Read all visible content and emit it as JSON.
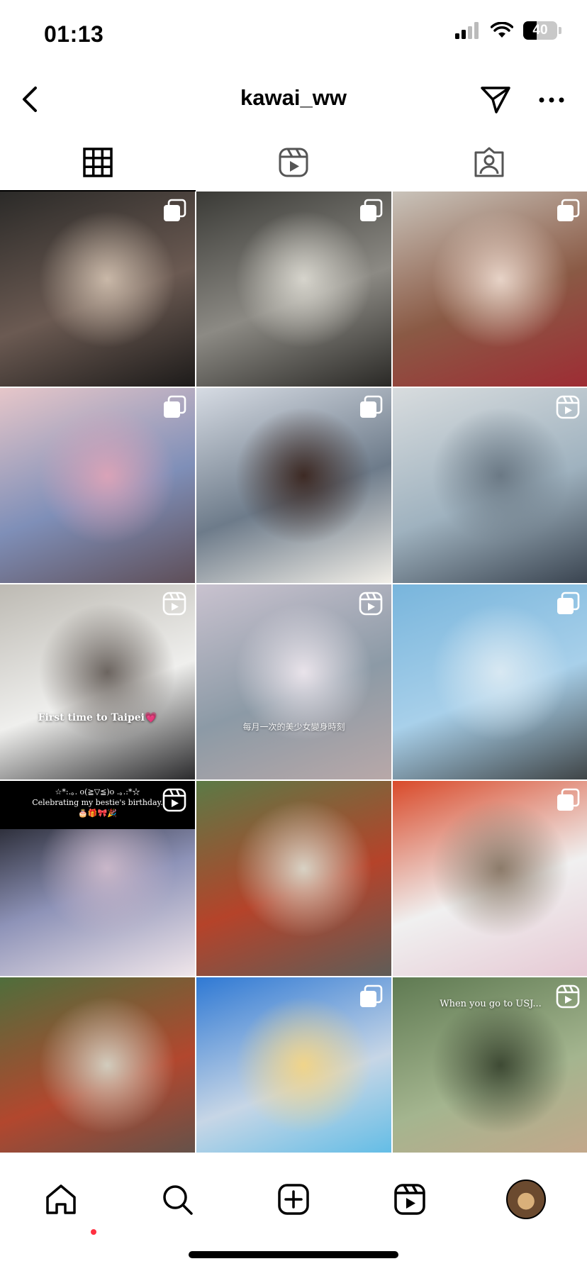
{
  "status": {
    "time": "01:13",
    "battery": "40",
    "battery_level": 0.4
  },
  "header": {
    "username": "kawai_ww"
  },
  "tabs": [
    {
      "name": "posts",
      "icon": "grid-icon",
      "active": true
    },
    {
      "name": "reels",
      "icon": "reels-icon",
      "active": false
    },
    {
      "name": "tagged",
      "icon": "tagged-icon",
      "active": false
    }
  ],
  "posts": [
    {
      "type": "carousel",
      "palette": [
        "#2b2a28",
        "#6b5a52",
        "#c9b8a8",
        "#1d1b1a"
      ]
    },
    {
      "type": "carousel",
      "palette": [
        "#3a3a36",
        "#8c8a84",
        "#d6d4cc",
        "#2a2926"
      ]
    },
    {
      "type": "carousel",
      "palette": [
        "#c9c3ba",
        "#8a5a45",
        "#e7d3c7",
        "#9e2c34"
      ]
    },
    {
      "type": "carousel",
      "palette": [
        "#e6c6c9",
        "#7f8fb8",
        "#d9a3b8",
        "#5e4e58"
      ]
    },
    {
      "type": "carousel",
      "palette": [
        "#d6dbe3",
        "#6d7b8a",
        "#3d2a24",
        "#f2efe8"
      ]
    },
    {
      "type": "reel",
      "palette": [
        "#d8dcde",
        "#9fb2bf",
        "#6b7985",
        "#3a4450"
      ]
    },
    {
      "type": "reel",
      "caption": "First time to Taipei💗",
      "palette": [
        "#bdbab3",
        "#efefed",
        "#6c6560",
        "#2b2b2d"
      ]
    },
    {
      "type": "reel",
      "caption": "每月一次的美少女變身時刻",
      "palette": [
        "#c9c2cf",
        "#8c9aa6",
        "#e9e3ea",
        "#b8a8a8"
      ]
    },
    {
      "type": "carousel",
      "palette": [
        "#78b5dc",
        "#a8d0ea",
        "#d8e8f2",
        "#3f4446"
      ]
    },
    {
      "type": "reel",
      "caption": "☆*:.｡. o(≧▽≦)o .｡.:*☆\nCelebrating my bestie's birthday.\n🎂🎁🎀🎉",
      "palette": [
        "#000000",
        "#8e93b8",
        "#c9b7c9",
        "#f0e6ea"
      ]
    },
    {
      "type": "none",
      "palette": [
        "#5b7a46",
        "#b5432a",
        "#d8d2c4",
        "#5f5d58"
      ]
    },
    {
      "type": "carousel",
      "palette": [
        "#d94a2a",
        "#f0f0f0",
        "#8c7b6a",
        "#e6c9d4"
      ]
    },
    {
      "type": "none",
      "palette": [
        "#4f6e3c",
        "#b2472e",
        "#d2ccbd",
        "#56544f"
      ]
    },
    {
      "type": "carousel",
      "palette": [
        "#2f79d4",
        "#c7d6e6",
        "#f0d48a",
        "#50b8e6"
      ]
    },
    {
      "type": "reel",
      "caption": "When you go to USJ...",
      "palette": [
        "#5f7a52",
        "#a4b58f",
        "#3e4a34",
        "#c9a58a"
      ]
    }
  ],
  "nav": [
    {
      "name": "home",
      "icon": "home-icon",
      "active": true
    },
    {
      "name": "search",
      "icon": "search-icon",
      "active": false
    },
    {
      "name": "create",
      "icon": "create-icon",
      "active": false
    },
    {
      "name": "reels",
      "icon": "reels-icon",
      "active": false
    },
    {
      "name": "profile",
      "icon": "profile-avatar",
      "active": false
    }
  ],
  "colors": {
    "accent": "#ff3040",
    "text": "#000000",
    "background": "#ffffff"
  }
}
